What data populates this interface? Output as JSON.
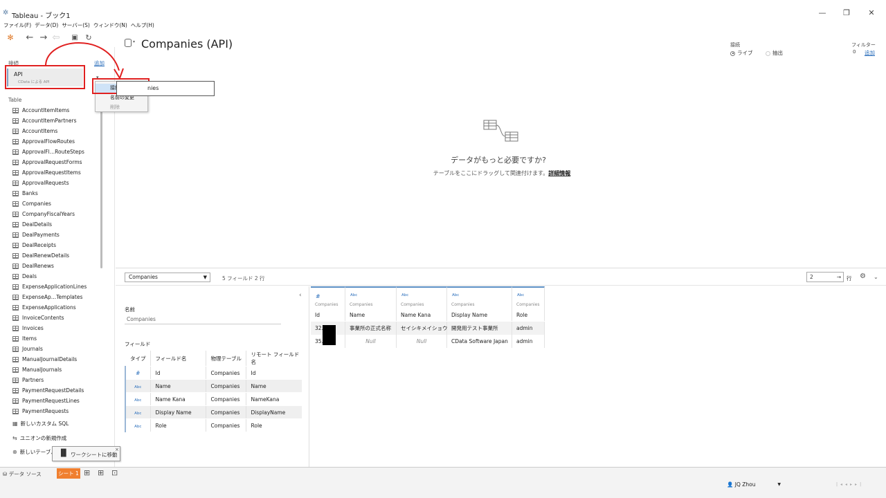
{
  "window": {
    "title": "Tableau - ブック1",
    "minimize": "—",
    "maximize": "❐",
    "close": "✕"
  },
  "menu": [
    "ファイル(F)",
    "データ(D)",
    "サーバー(S)",
    "ウィンドウ(N)",
    "ヘルプ(H)"
  ],
  "left": {
    "connections_label": "接続",
    "add_label": "追加",
    "connection_name": "API",
    "connection_sub": "CData による API",
    "table_label": "Table",
    "tables": [
      "AccountItemItems",
      "AccountItemPartners",
      "AccountItems",
      "ApprovalFlowRoutes",
      "ApprovalFl…RouteSteps",
      "ApprovalRequestForms",
      "ApprovalRequestItems",
      "ApprovalRequests",
      "Banks",
      "Companies",
      "CompanyFiscalYears",
      "DealDetails",
      "DealPayments",
      "DealReceipts",
      "DealRenewDetails",
      "DealRenews",
      "Deals",
      "ExpenseApplicationLines",
      "ExpenseAp…Templates",
      "ExpenseApplications",
      "InvoiceContents",
      "Invoices",
      "Items",
      "Journals",
      "ManualJournalDetails",
      "ManualJournals",
      "Partners",
      "PaymentRequestDetails",
      "PaymentRequestLines",
      "PaymentRequests"
    ],
    "custom_sql": "新しいカスタム SQL",
    "new_union": "ユニオンの新規作成",
    "new_table": "新しいテーブル"
  },
  "context_menu": {
    "edit_connection": "接続の編集...",
    "rename": "名前の変更",
    "delete": "削除"
  },
  "header": {
    "title": "Companies (API)",
    "connection_label": "接続",
    "live": "ライブ",
    "extract": "抽出",
    "filters_label": "フィルター",
    "filters_count": "0",
    "filters_add": "追加"
  },
  "canvas": {
    "table_label": "nies",
    "need_more_title": "データがもっと必要ですか?",
    "need_more_sub": "テーブルをここにドラッグして関連付けます。",
    "details_link": "詳細情報"
  },
  "grid_toolbar": {
    "selected_table": "Companies",
    "summary": "5 フィールド 2 行",
    "rows_value": "2",
    "rows_label": "行"
  },
  "metadata": {
    "name_label": "名前",
    "name_value": "Companies",
    "fields_label": "フィールド",
    "columns": [
      "タイプ",
      "フィールド名",
      "物理テーブル",
      "リモート フィールド名"
    ],
    "rows": [
      {
        "type": "#",
        "field": "Id",
        "table": "Companies",
        "remote": "Id"
      },
      {
        "type": "Abc",
        "field": "Name",
        "table": "Companies",
        "remote": "Name"
      },
      {
        "type": "Abc",
        "field": "Name Kana",
        "table": "Companies",
        "remote": "NameKana"
      },
      {
        "type": "Abc",
        "field": "Display Name",
        "table": "Companies",
        "remote": "DisplayName"
      },
      {
        "type": "Abc",
        "field": "Role",
        "table": "Companies",
        "remote": "Role"
      }
    ]
  },
  "data_grid": {
    "columns": [
      {
        "type": "#",
        "source": "Companies",
        "name": "Id"
      },
      {
        "type": "Abc",
        "source": "Companies",
        "name": "Name"
      },
      {
        "type": "Abc",
        "source": "Companies",
        "name": "Name Kana"
      },
      {
        "type": "Abc",
        "source": "Companies",
        "name": "Display Name"
      },
      {
        "type": "Abc",
        "source": "Companies",
        "name": "Role"
      }
    ],
    "rows": [
      [
        "32…3",
        "事業所の正式名称",
        "セイシキメイショウ",
        "開発用テスト事業所",
        "admin"
      ],
      [
        "35…4",
        "Null",
        "Null",
        "CData Software Japan",
        "admin"
      ]
    ]
  },
  "status": {
    "datasource_tab": "データ ソース",
    "sheet_tab": "シート 1",
    "goto_worksheet": "ワークシートに移動",
    "user": "JQ Zhou"
  },
  "colors": {
    "accent": "#2a6ebb",
    "highlight_red": "#e02020",
    "sheet_tab": "#f07f2f"
  }
}
